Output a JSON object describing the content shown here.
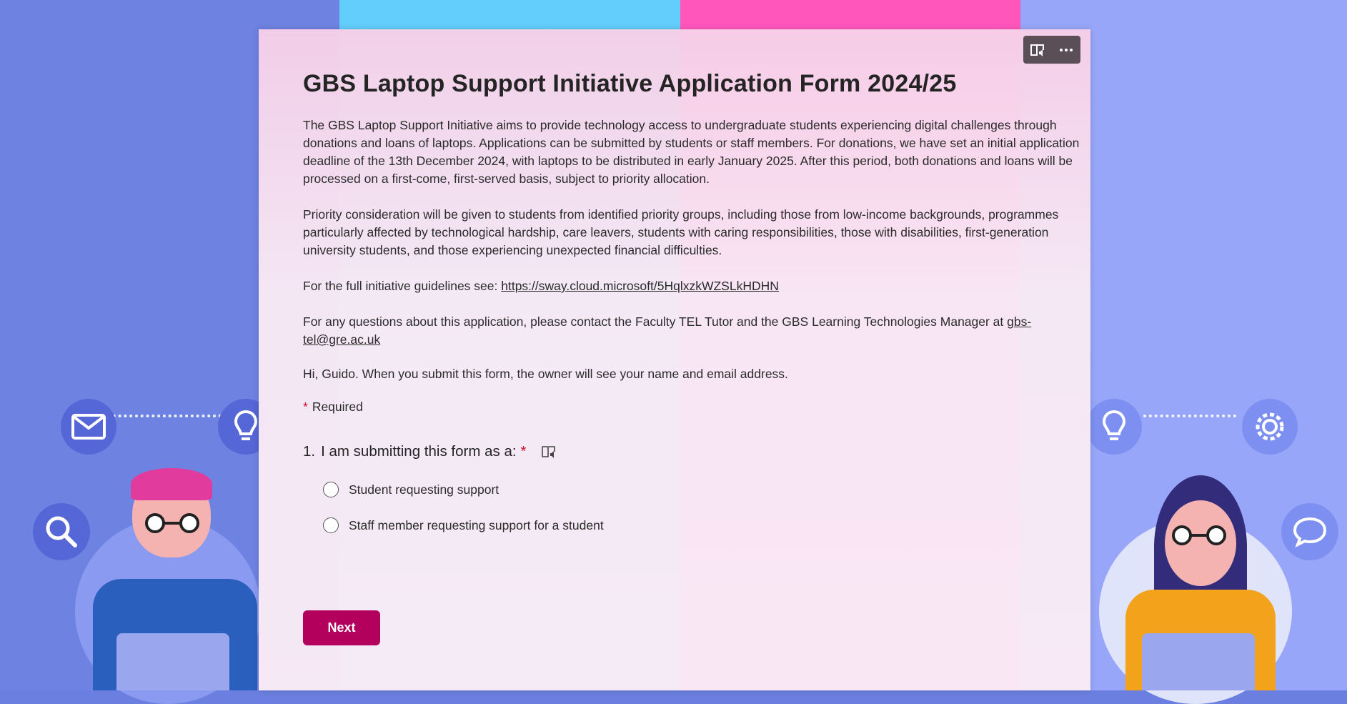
{
  "colors": {
    "bg_left": "#6e82e2",
    "bg_cyan": "#63cdfb",
    "bg_pink": "#ff56bb",
    "bg_right": "#97a6f8",
    "accent": "#b3005d",
    "required_star": "#c8102e"
  },
  "toolbar": {
    "immersive_reader_icon": "immersive-reader-icon",
    "more_icon": "more-options-icon"
  },
  "form": {
    "title": "GBS Laptop Support Initiative Application Form 2024/25",
    "paragraphs": [
      "The GBS Laptop Support Initiative aims to provide technology access to undergraduate students experiencing digital challenges through donations and loans of laptops. Applications can be submitted by students or staff members. For donations, we have set an initial application deadline of the 13th December 2024, with laptops to be distributed in early January 2025. After this period, both donations and loans will be processed on a first-come, first-served basis, subject to priority allocation.",
      "Priority consideration will be given to students from identified priority groups, including those from low-income backgrounds, programmes particularly affected by technological hardship, care leavers, students with caring responsibilities, those with disabilities, first-generation university students, and those experiencing unexpected financial difficulties."
    ],
    "guidelines_prefix": "For the full initiative guidelines see: ",
    "guidelines_link": "https://sway.cloud.microsoft/5HqlxzkWZSLkHDHN",
    "contact_prefix": "For any questions about this application, please contact the Faculty TEL Tutor and the GBS Learning Technologies Manager at ",
    "contact_email": "gbs-tel@gre.ac.uk",
    "greeting": "Hi, Guido. When you submit this form, the owner will see your name and email address.",
    "required_star": "*",
    "required_label": "Required",
    "question": {
      "number": "1.",
      "text": "I am submitting this form as a:",
      "star": "*",
      "options": [
        "Student requesting support",
        "Staff member requesting support for a student"
      ]
    },
    "next_label": "Next"
  }
}
